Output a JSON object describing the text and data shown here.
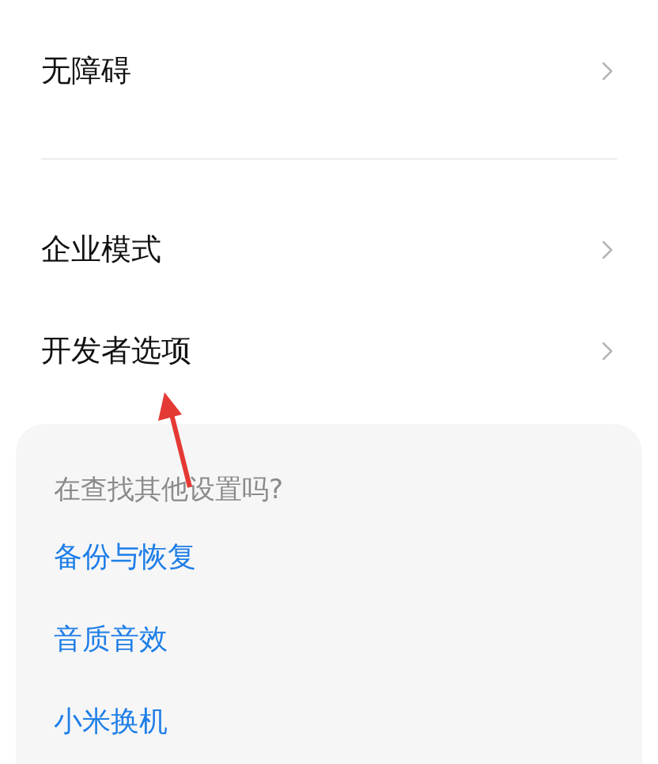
{
  "groups": [
    {
      "items": [
        {
          "label": "无障碍"
        }
      ]
    },
    {
      "items": [
        {
          "label": "企业模式"
        },
        {
          "label": "开发者选项"
        }
      ]
    }
  ],
  "suggestions": {
    "title": "在查找其他设置吗?",
    "links": [
      "备份与恢复",
      "音质音效",
      "小米换机"
    ]
  }
}
